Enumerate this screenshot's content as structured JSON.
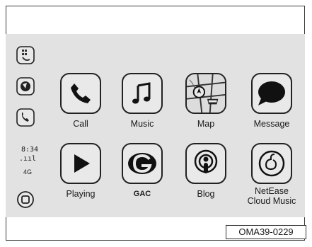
{
  "status": {
    "time": "8:34",
    "signal": ".ııl",
    "network": "4G"
  },
  "sidebar_icons": [
    "phone-keypad-icon",
    "maps-mini-icon",
    "phone-mini-icon",
    "home-button-icon"
  ],
  "apps": [
    {
      "label": "Call",
      "icon": "phone-icon"
    },
    {
      "label": "Music",
      "icon": "music-note-icon"
    },
    {
      "label": "Map",
      "icon": "map-icon"
    },
    {
      "label": "Message",
      "icon": "message-bubble-icon"
    },
    {
      "label": "Playing",
      "icon": "play-icon"
    },
    {
      "label": "GAC",
      "icon": "gac-logo-icon"
    },
    {
      "label": "Blog",
      "icon": "podcast-icon"
    },
    {
      "label": "NetEase Cloud Music",
      "icon": "netease-music-icon"
    }
  ],
  "figure_code": "OMA39-0229"
}
